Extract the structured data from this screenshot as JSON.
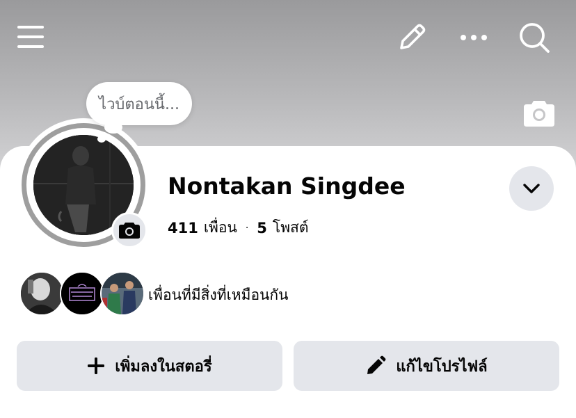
{
  "profile": {
    "name": "Nontakan Singdee",
    "friends_count": "411",
    "friends_label": "เพื่อน",
    "separator": "·",
    "posts_count": "5",
    "posts_label": "โพสต์",
    "note_bubble": "ไวบ์ตอนนี้..."
  },
  "mutual": {
    "text": "เพื่อนที่มีสิ่งที่เหมือนกัน",
    "avatars": [
      "avatar-1",
      "avatar-2",
      "avatar-3"
    ]
  },
  "actions": {
    "add_story_label": "เพิ่มลงในสตอรี่",
    "edit_profile_label": "แก้ไขโปรไฟล์"
  },
  "icons": {
    "menu": "hamburger-menu-icon",
    "edit": "pencil-icon",
    "more": "more-dots-icon",
    "search": "search-icon",
    "cover_camera": "camera-icon",
    "avatar_camera": "camera-icon",
    "expand": "chevron-down-icon",
    "add": "plus-icon",
    "edit_profile": "pencil-icon"
  },
  "colors": {
    "button_bg": "#e4e6eb",
    "text_primary": "#050505",
    "text_secondary": "#65676b"
  }
}
